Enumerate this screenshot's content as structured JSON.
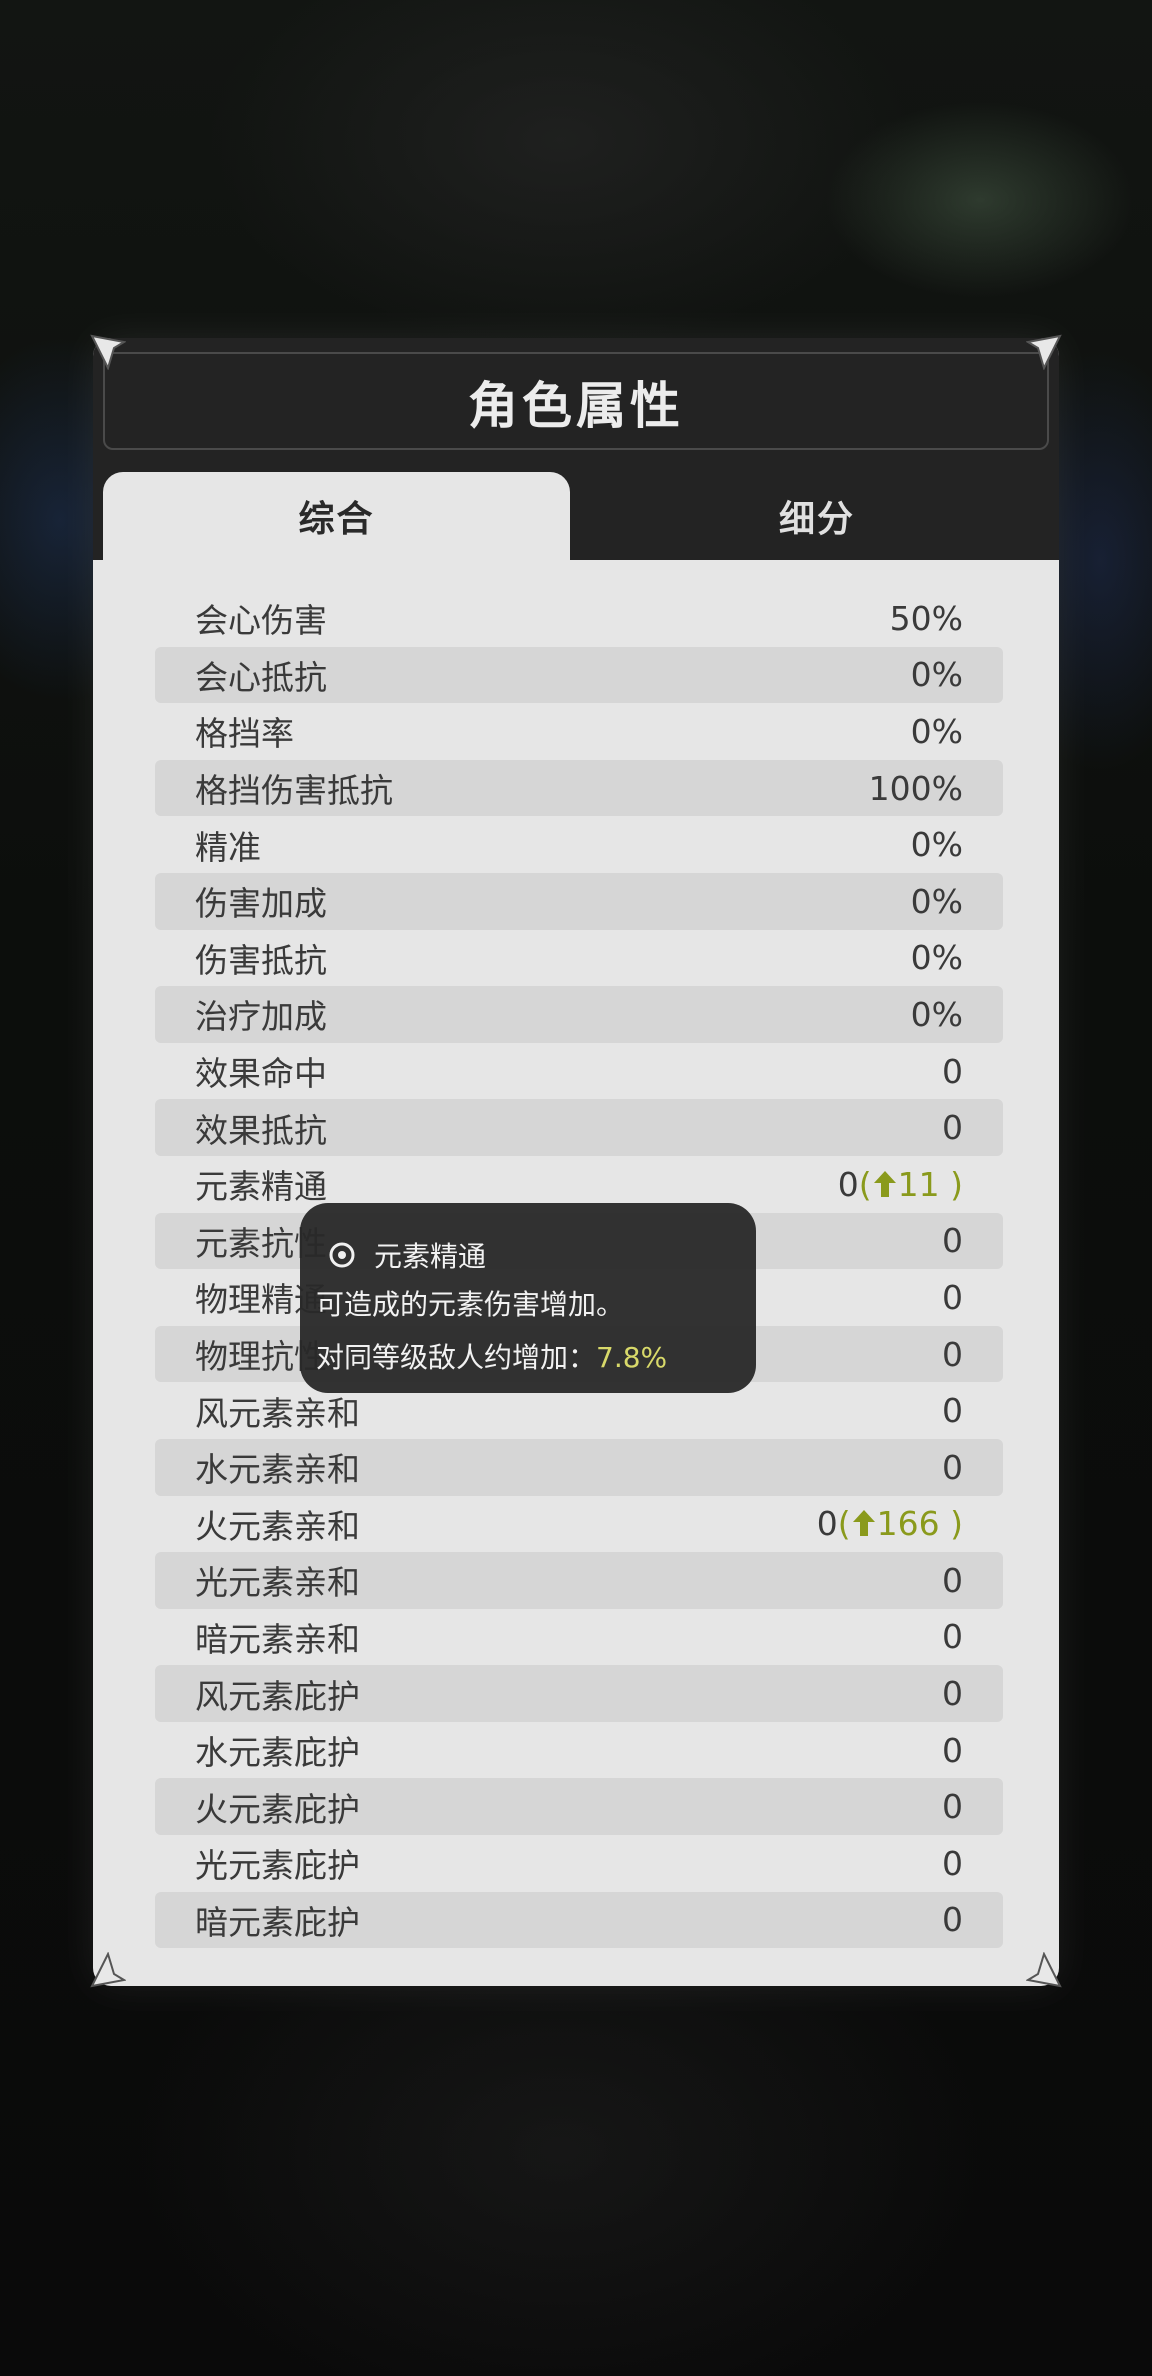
{
  "title": "角色属性",
  "tabs": [
    {
      "label": "综合",
      "active": true
    },
    {
      "label": "细分",
      "active": false
    }
  ],
  "stats": [
    {
      "label": "会心伤害",
      "value": "50%"
    },
    {
      "label": "会心抵抗",
      "value": "0%"
    },
    {
      "label": "格挡率",
      "value": "0%"
    },
    {
      "label": "格挡伤害抵抗",
      "value": "100%"
    },
    {
      "label": "精准",
      "value": "0%"
    },
    {
      "label": "伤害加成",
      "value": "0%"
    },
    {
      "label": "伤害抵抗",
      "value": "0%"
    },
    {
      "label": "治疗加成",
      "value": "0%"
    },
    {
      "label": "效果命中",
      "value": "0"
    },
    {
      "label": "效果抵抗",
      "value": "0"
    },
    {
      "label": "元素精通",
      "value": "0",
      "bonus": "11"
    },
    {
      "label": "元素抗性",
      "value": "0"
    },
    {
      "label": "物理精通",
      "value": "0"
    },
    {
      "label": "物理抗性",
      "value": "0"
    },
    {
      "label": "风元素亲和",
      "value": "0"
    },
    {
      "label": "水元素亲和",
      "value": "0"
    },
    {
      "label": "火元素亲和",
      "value": "0",
      "bonus": "166"
    },
    {
      "label": "光元素亲和",
      "value": "0"
    },
    {
      "label": "暗元素亲和",
      "value": "0"
    },
    {
      "label": "风元素庇护",
      "value": "0"
    },
    {
      "label": "水元素庇护",
      "value": "0"
    },
    {
      "label": "火元素庇护",
      "value": "0"
    },
    {
      "label": "光元素庇护",
      "value": "0"
    },
    {
      "label": "暗元素庇护",
      "value": "0"
    }
  ],
  "tooltip": {
    "title": "元素精通",
    "description": "可造成的元素伤害增加。",
    "line_label": "对同等级敌人约增加：",
    "line_value": "7.8%"
  },
  "colors": {
    "bonus": "#8a9a1c",
    "tooltip_value": "#d8d96a"
  }
}
